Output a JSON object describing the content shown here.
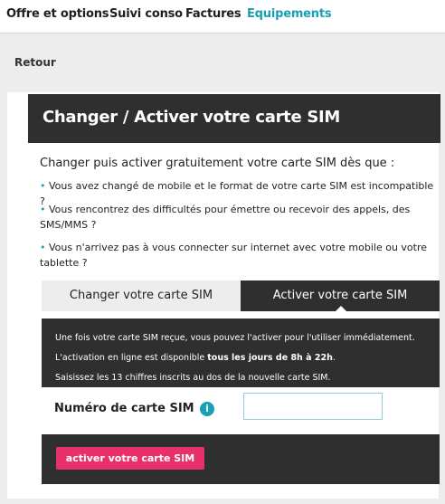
{
  "nav": {
    "items": [
      {
        "label": "Offre et options"
      },
      {
        "label": "Suivi conso"
      },
      {
        "label": "Factures"
      },
      {
        "label": "Equipements"
      }
    ]
  },
  "back": {
    "label": "Retour"
  },
  "header": {
    "title": "Changer / Activer votre carte SIM"
  },
  "intro": "Changer puis activer gratuitement votre carte SIM dès que :",
  "bullets": [
    "Vous avez changé de mobile et le format de votre carte SIM est incompatible ?",
    "Vous rencontrez des difficultés pour émettre ou recevoir des appels, des SMS/MMS ?",
    "Vous n'arrivez pas à vous connecter sur internet avec votre mobile ou votre tablette ?"
  ],
  "tabs": [
    {
      "label": "Changer votre carte SIM"
    },
    {
      "label": "Activer votre carte SIM"
    }
  ],
  "info": {
    "line1": "Une fois votre carte SIM reçue, vous pouvez l'activer pour l'utiliser immédiatement.",
    "line2_prefix": "L'activation en ligne est disponible ",
    "line2_bold": "tous les jours de 8h à 22h",
    "line2_suffix": ".",
    "line3": "Saisissez les 13 chiffres inscrits au dos de la nouvelle carte SIM."
  },
  "form": {
    "sim_label": "Numéro de carte SIM",
    "info_icon": "i",
    "sim_value": "",
    "submit_label": "activer votre carte SIM"
  },
  "colors": {
    "accent": "#1aa0b4",
    "brand_pink": "#e8316b",
    "dark": "#2f2f2f"
  }
}
